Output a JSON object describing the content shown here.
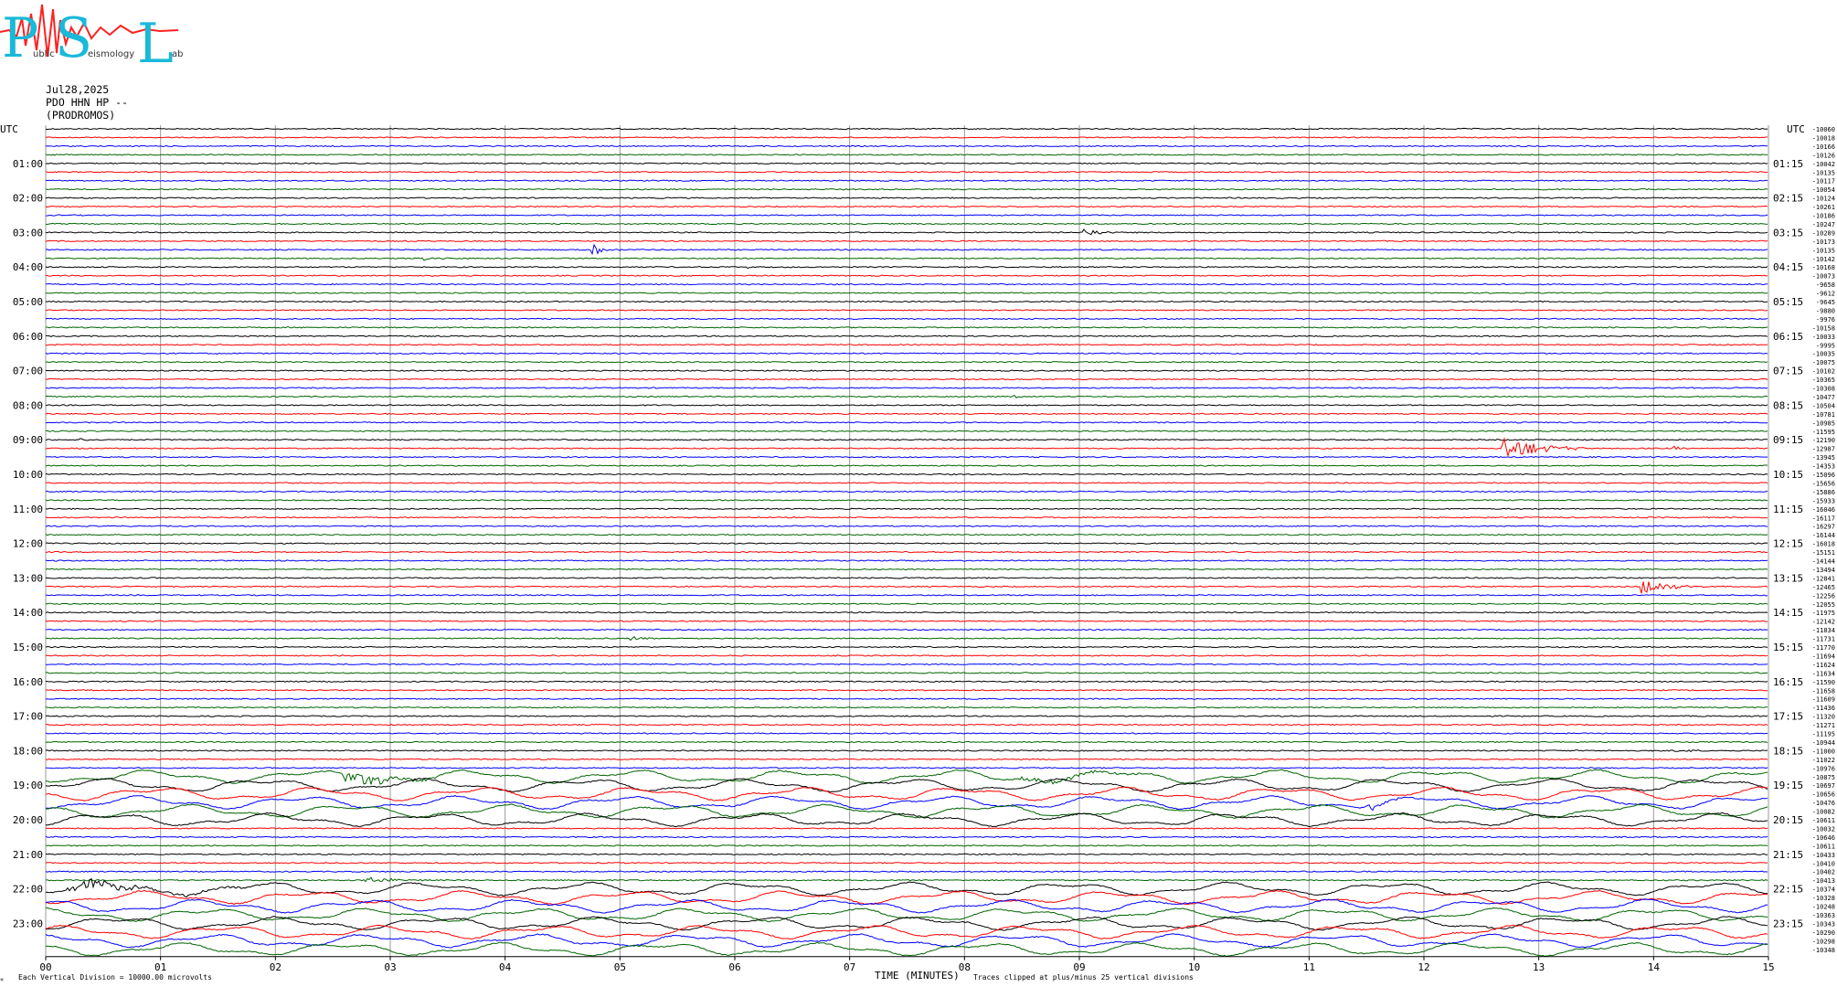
{
  "logo": {
    "big_letters": [
      "P",
      "S",
      "L"
    ],
    "small_text": [
      "ublic",
      "eismology",
      "ab"
    ],
    "colors": {
      "letters": "#19b9d9",
      "trace": "#ff2020"
    }
  },
  "header": {
    "date": "Jul28,2025",
    "station": "PDO HHN HP --",
    "site": "(PRODROMOS)"
  },
  "left_axis_label": "UTC",
  "right_axis_label": "UTC",
  "xaxis_title": "TIME (MINUTES)",
  "footer_left": "Each Vertical Division = 10000.00 microvolts",
  "footer_right": "Traces clipped at plus/minus 25 vertical divisions",
  "footer_corner": "«",
  "chart_data": {
    "type": "line",
    "title": "",
    "xlabel": "TIME (MINUTES)",
    "xlim": [
      0,
      15
    ],
    "x_ticks": [
      "00",
      "01",
      "02",
      "03",
      "04",
      "05",
      "06",
      "07",
      "08",
      "09",
      "10",
      "11",
      "12",
      "13",
      "14",
      "15"
    ],
    "rows_per_hour": 4,
    "row_minutes": 15,
    "trace_colors": [
      "#000000",
      "#ff0000",
      "#0000ff",
      "#006400"
    ],
    "left_hour_labels": [
      "",
      "01:00",
      "02:00",
      "03:00",
      "04:00",
      "05:00",
      "06:00",
      "07:00",
      "08:00",
      "09:00",
      "10:00",
      "11:00",
      "12:00",
      "13:00",
      "14:00",
      "15:00",
      "16:00",
      "17:00",
      "18:00",
      "19:00",
      "20:00",
      "21:00",
      "22:00",
      "23:00"
    ],
    "right_hour_labels": [
      "",
      "01:15",
      "02:15",
      "03:15",
      "04:15",
      "05:15",
      "06:15",
      "07:15",
      "08:15",
      "09:15",
      "10:15",
      "11:15",
      "12:15",
      "13:15",
      "14:15",
      "15:15",
      "16:15",
      "17:15",
      "18:15",
      "19:15",
      "20:15",
      "21:15",
      "22:15",
      "23:15"
    ],
    "offsets": [
      "-10060",
      "-10018",
      "-10166",
      "-10126",
      "-10042",
      "-10135",
      "-10117",
      "-10054",
      "-10124",
      "-10261",
      "-10186",
      "-10247",
      "-10289",
      "-10173",
      "-10135",
      "-10142",
      "-10168",
      "-10073",
      "-9658",
      "-9612",
      "-9645",
      "-9880",
      "-9976",
      "-10158",
      "-10033",
      "-9995",
      "-10035",
      "-10075",
      "-10102",
      "-10365",
      "-10308",
      "-10477",
      "-10504",
      "-10781",
      "-10985",
      "-11595",
      "-12190",
      "-12987",
      "-13945",
      "-14353",
      "-15096",
      "-15656",
      "-15886",
      "-15933",
      "-16046",
      "-16117",
      "-16297",
      "-16144",
      "-16018",
      "-15151",
      "-14144",
      "-13494",
      "-12841",
      "-12465",
      "-12256",
      "-12055",
      "-11975",
      "-12142",
      "-11834",
      "-11731",
      "-11770",
      "-11694",
      "-11624",
      "-11634",
      "-11590",
      "-11658",
      "-11609",
      "-11436",
      "-11320",
      "-11271",
      "-11195",
      "-10944",
      "-11000",
      "-11022",
      "-10976",
      "-10875",
      "-10697",
      "-10656",
      "-10476",
      "-10082",
      "-10611",
      "-10032",
      "-10646",
      "-10611",
      "-10433",
      "-10410",
      "-10402",
      "-10413",
      "-10374",
      "-10328",
      "-10248",
      "-10363",
      "-10343",
      "-10290",
      "-10298",
      "-10348"
    ],
    "events": [
      {
        "row": 12,
        "minute": 9.05,
        "duration": 0.35,
        "amplitude": 5
      },
      {
        "row": 14,
        "minute": 4.75,
        "duration": 0.3,
        "amplitude": 6
      },
      {
        "row": 15,
        "minute": 3.3,
        "duration": 0.4,
        "amplitude": 3
      },
      {
        "row": 16,
        "minute": 6.1,
        "duration": 0.1,
        "amplitude": 2
      },
      {
        "row": 31,
        "minute": 8.45,
        "duration": 0.1,
        "amplitude": 2
      },
      {
        "row": 36,
        "minute": 0.3,
        "duration": 0.2,
        "amplitude": 1.5
      },
      {
        "row": 37,
        "minute": 12.7,
        "duration": 0.7,
        "amplitude": 14
      },
      {
        "row": 37,
        "minute": 14.2,
        "duration": 0.15,
        "amplitude": 2
      },
      {
        "row": 53,
        "minute": 13.9,
        "duration": 0.55,
        "amplitude": 9
      },
      {
        "row": 59,
        "minute": 5.1,
        "duration": 0.35,
        "amplitude": 2
      },
      {
        "row": 72,
        "minute": 14.2,
        "duration": 0.3,
        "amplitude": 2
      },
      {
        "row": 75,
        "minute": 2.6,
        "duration": 0.9,
        "amplitude": 9
      },
      {
        "row": 75,
        "minute": 8.5,
        "duration": 1.7,
        "amplitude": 3
      },
      {
        "row": 78,
        "minute": 11.5,
        "duration": 0.4,
        "amplitude": 5
      },
      {
        "row": 87,
        "minute": 2.8,
        "duration": 0.5,
        "amplitude": 4
      },
      {
        "row": 88,
        "minute": 0.2,
        "duration": 2.0,
        "amplitude": 6
      }
    ],
    "noisy_rows_start": 75,
    "noisy_rows_end": 80,
    "noisy_rows2_start": 88,
    "noisy_rows2_end": 95
  }
}
